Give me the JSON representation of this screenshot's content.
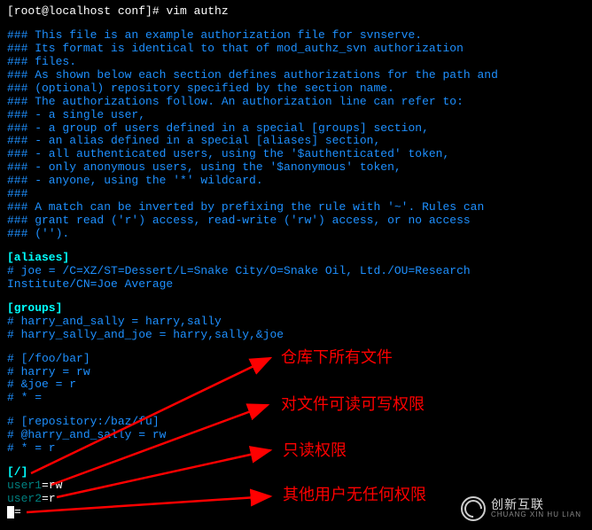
{
  "prompt": {
    "user_host": "[root@localhost conf]#",
    "command": "vim authz"
  },
  "comments": {
    "c1": "### This file is an example authorization file for svnserve.",
    "c2": "### Its format is identical to that of mod_authz_svn authorization",
    "c3": "### files.",
    "c4": "### As shown below each section defines authorizations for the path and",
    "c5": "### (optional) repository specified by the section name.",
    "c6": "### The authorizations follow. An authorization line can refer to:",
    "c7": "###  - a single user,",
    "c8": "###  - a group of users defined in a special [groups] section,",
    "c9": "###  - an alias defined in a special [aliases] section,",
    "c10": "###  - all authenticated users, using the '$authenticated' token,",
    "c11": "###  - only anonymous users, using the '$anonymous' token,",
    "c12": "###  - anyone, using the '*' wildcard.",
    "c13": "###",
    "c14": "### A match can be inverted by prefixing the rule with '~'. Rules can",
    "c15": "### grant read ('r') access, read-write ('rw') access, or no access",
    "c16": "### ('').",
    "hash3": "###"
  },
  "aliases": {
    "header": "[aliases]",
    "joe": "# joe = /C=XZ/ST=Dessert/L=Snake City/O=Snake Oil, Ltd./OU=Research Institute/CN=Joe Average"
  },
  "groups": {
    "header": "[groups]",
    "harry_sally": "# harry_and_sally = harry,sally",
    "harry_sally_joe": "# harry_sally_and_joe = harry,sally,&joe"
  },
  "foobar": {
    "header": "# [/foo/bar]",
    "harry": "# harry = rw",
    "joe": "# &joe = r",
    "star": "# * ="
  },
  "repo": {
    "header_pre": "# [repository:/baz/fu",
    "header_post": "]",
    "harry_sally": "# @harry_and_sally = rw",
    "star": "# * = r"
  },
  "root": {
    "header": "[/]",
    "user1_key": "user1",
    "user1_val": "=rw",
    "user2_key": "user2",
    "user2_val": "=r",
    "star_key": "*",
    "star_post": "="
  },
  "annotations": {
    "a1": "仓库下所有文件",
    "a2": "对文件可读可写权限",
    "a3": "只读权限",
    "a4": "其他用户无任何权限"
  },
  "logo": {
    "main": "创新互联",
    "sub": "CHUANG XIN HU LIAN"
  }
}
